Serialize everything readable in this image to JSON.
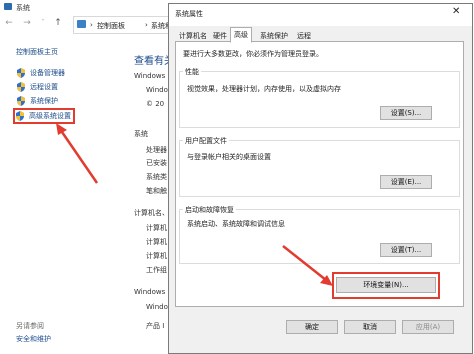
{
  "bg_window": {
    "title": "系统",
    "breadcrumb": [
      "控制面板",
      "系统和安全"
    ],
    "sidebar": {
      "home": "控制面板主页",
      "items": [
        {
          "label": "设备管理器",
          "icon": "shield-icon"
        },
        {
          "label": "远程设置",
          "icon": "shield-icon"
        },
        {
          "label": "系统保护",
          "icon": "shield-icon"
        },
        {
          "label": "高级系统设置",
          "icon": "shield-icon"
        }
      ],
      "see_also": "另请参阅",
      "security_maintenance": "安全和维护"
    },
    "main": {
      "heading": "查看有关",
      "windows_section": "Windows",
      "windows_line": "Windo",
      "copyright": "© 20",
      "system_section": "系统",
      "system_rows": [
        "处理器",
        "已安装",
        "系统类",
        "笔和触"
      ],
      "computer_section": "计算机名、",
      "computer_rows": [
        "计算机",
        "计算机",
        "计算机",
        "工作组"
      ],
      "activation_section": "Windows",
      "activation_row": "Windo",
      "product_row": "产品 I"
    }
  },
  "dialog": {
    "title": "系统属性",
    "close_icon": "close-icon",
    "tabs": [
      "计算机名",
      "硬件",
      "高级",
      "系统保护",
      "远程"
    ],
    "active_tab": "高级",
    "admin_note": "要进行大多数更改，你必须作为管理员登录。",
    "performance": {
      "label": "性能",
      "desc": "视觉效果，处理器计划，内存使用，以及虚拟内存",
      "button": "设置(S)..."
    },
    "user_profiles": {
      "label": "用户配置文件",
      "desc": "与登录帐户相关的桌面设置",
      "button": "设置(E)..."
    },
    "startup_recovery": {
      "label": "启动和故障恢复",
      "desc": "系统启动、系统故障和调试信息",
      "button": "设置(T)..."
    },
    "env_button": "环境变量(N)...",
    "ok_button": "确定",
    "cancel_button": "取消",
    "apply_button": "应用(A)"
  },
  "colors": {
    "highlight_red": "#e23b2f",
    "link_blue": "#1a4a8a"
  }
}
